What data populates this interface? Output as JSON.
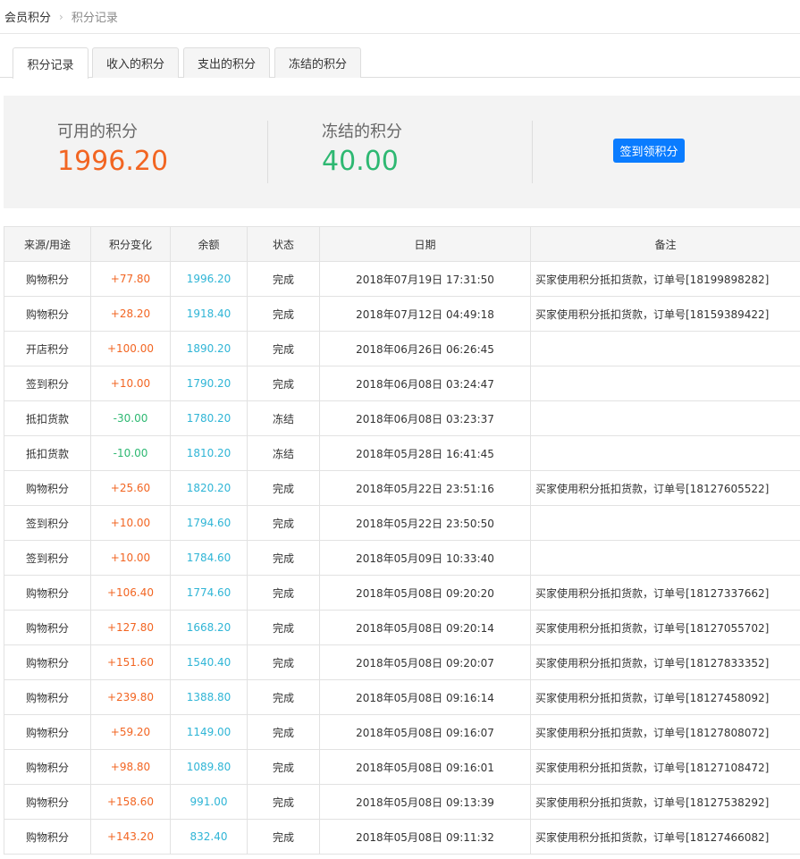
{
  "breadcrumb": {
    "root": "会员积分",
    "separator": "›",
    "current": "积分记录"
  },
  "tabs": [
    {
      "label": "积分记录",
      "active": true
    },
    {
      "label": "收入的积分",
      "active": false
    },
    {
      "label": "支出的积分",
      "active": false
    },
    {
      "label": "冻结的积分",
      "active": false
    }
  ],
  "summary": {
    "available_label": "可用的积分",
    "available_value": "1996.20",
    "frozen_label": "冻结的积分",
    "frozen_value": "40.00",
    "sign_button": "签到领积分"
  },
  "colors": {
    "positive": "#f26522",
    "negative": "#2eb872",
    "balance": "#2fb5d6",
    "button": "#0a7cff"
  },
  "table": {
    "headers": [
      "来源/用途",
      "积分变化",
      "余额",
      "状态",
      "日期",
      "备注"
    ],
    "rows": [
      {
        "source": "购物积分",
        "change": "+77.80",
        "balance": "1996.20",
        "status": "完成",
        "date": "2018年07月19日 17:31:50",
        "note": "买家使用积分抵扣货款，订单号[18199898282]"
      },
      {
        "source": "购物积分",
        "change": "+28.20",
        "balance": "1918.40",
        "status": "完成",
        "date": "2018年07月12日 04:49:18",
        "note": "买家使用积分抵扣货款，订单号[18159389422]"
      },
      {
        "source": "开店积分",
        "change": "+100.00",
        "balance": "1890.20",
        "status": "完成",
        "date": "2018年06月26日 06:26:45",
        "note": ""
      },
      {
        "source": "签到积分",
        "change": "+10.00",
        "balance": "1790.20",
        "status": "完成",
        "date": "2018年06月08日 03:24:47",
        "note": ""
      },
      {
        "source": "抵扣货款",
        "change": "-30.00",
        "balance": "1780.20",
        "status": "冻结",
        "date": "2018年06月08日 03:23:37",
        "note": ""
      },
      {
        "source": "抵扣货款",
        "change": "-10.00",
        "balance": "1810.20",
        "status": "冻结",
        "date": "2018年05月28日 16:41:45",
        "note": ""
      },
      {
        "source": "购物积分",
        "change": "+25.60",
        "balance": "1820.20",
        "status": "完成",
        "date": "2018年05月22日 23:51:16",
        "note": "买家使用积分抵扣货款，订单号[18127605522]"
      },
      {
        "source": "签到积分",
        "change": "+10.00",
        "balance": "1794.60",
        "status": "完成",
        "date": "2018年05月22日 23:50:50",
        "note": ""
      },
      {
        "source": "签到积分",
        "change": "+10.00",
        "balance": "1784.60",
        "status": "完成",
        "date": "2018年05月09日 10:33:40",
        "note": ""
      },
      {
        "source": "购物积分",
        "change": "+106.40",
        "balance": "1774.60",
        "status": "完成",
        "date": "2018年05月08日 09:20:20",
        "note": "买家使用积分抵扣货款，订单号[18127337662]"
      },
      {
        "source": "购物积分",
        "change": "+127.80",
        "balance": "1668.20",
        "status": "完成",
        "date": "2018年05月08日 09:20:14",
        "note": "买家使用积分抵扣货款，订单号[18127055702]"
      },
      {
        "source": "购物积分",
        "change": "+151.60",
        "balance": "1540.40",
        "status": "完成",
        "date": "2018年05月08日 09:20:07",
        "note": "买家使用积分抵扣货款，订单号[18127833352]"
      },
      {
        "source": "购物积分",
        "change": "+239.80",
        "balance": "1388.80",
        "status": "完成",
        "date": "2018年05月08日 09:16:14",
        "note": "买家使用积分抵扣货款，订单号[18127458092]"
      },
      {
        "source": "购物积分",
        "change": "+59.20",
        "balance": "1149.00",
        "status": "完成",
        "date": "2018年05月08日 09:16:07",
        "note": "买家使用积分抵扣货款，订单号[18127808072]"
      },
      {
        "source": "购物积分",
        "change": "+98.80",
        "balance": "1089.80",
        "status": "完成",
        "date": "2018年05月08日 09:16:01",
        "note": "买家使用积分抵扣货款，订单号[18127108472]"
      },
      {
        "source": "购物积分",
        "change": "+158.60",
        "balance": "991.00",
        "status": "完成",
        "date": "2018年05月08日 09:13:39",
        "note": "买家使用积分抵扣货款，订单号[18127538292]"
      },
      {
        "source": "购物积分",
        "change": "+143.20",
        "balance": "832.40",
        "status": "完成",
        "date": "2018年05月08日 09:11:32",
        "note": "买家使用积分抵扣货款，订单号[18127466082]"
      }
    ]
  }
}
